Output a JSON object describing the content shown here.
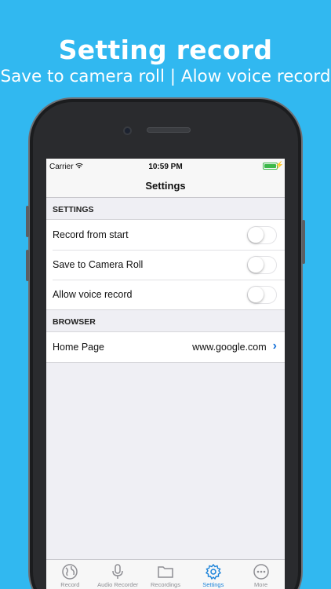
{
  "promo": {
    "title": "Setting record",
    "subtitle": "Save to camera roll | Alow voice record"
  },
  "status": {
    "carrier": "Carrier",
    "time": "10:59 PM",
    "battery_color": "#3cb84a"
  },
  "nav": {
    "title": "Settings"
  },
  "sections": {
    "settings": {
      "header": "SETTINGS",
      "rows": [
        {
          "label": "Record from start",
          "on": false
        },
        {
          "label": "Save to Camera Roll",
          "on": false
        },
        {
          "label": "Allow voice record",
          "on": false
        }
      ]
    },
    "browser": {
      "header": "BROWSER",
      "home_label": "Home Page",
      "home_value": "www.google.com"
    }
  },
  "tabs": [
    {
      "label": "Record",
      "icon": "globe-icon"
    },
    {
      "label": "Audio Recorder",
      "icon": "microphone-icon"
    },
    {
      "label": "Recordings",
      "icon": "folder-icon"
    },
    {
      "label": "Settings",
      "icon": "gear-icon",
      "active": true
    },
    {
      "label": "More",
      "icon": "more-icon"
    }
  ],
  "colors": {
    "background": "#31b8f0",
    "accent": "#1a82d9"
  }
}
